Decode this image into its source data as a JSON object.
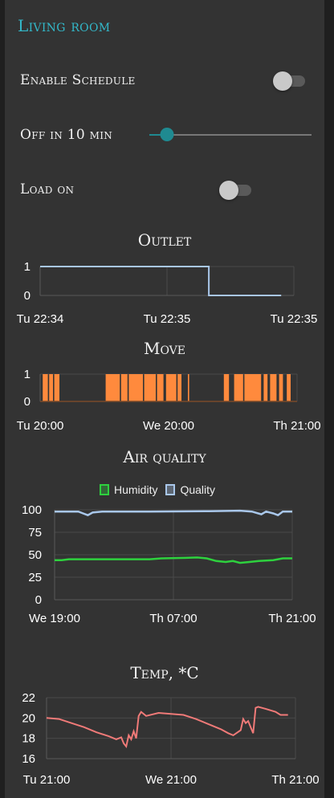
{
  "group": {
    "title": "Living room"
  },
  "controls": {
    "schedule": {
      "label": "Enable Schedule",
      "on": false
    },
    "timer": {
      "label": "Off in 10 min",
      "level": 0.11
    },
    "load": {
      "label": "Load on",
      "on": false
    }
  },
  "colors": {
    "background": "#333333",
    "title_accent": "#33b8c9",
    "slider_accent": "#1f8a91",
    "outlet_line": "#a9c7ea",
    "move_bars": "#ff8a3d",
    "humidity": "#2ed13e",
    "quality": "#a9c7ea",
    "temp": "#f07a78"
  },
  "chart_data": [
    {
      "type": "line",
      "title": "Outlet",
      "x_ticks": [
        "Tu 22:34",
        "Tu 22:35",
        "Tu 22:35"
      ],
      "y_ticks": [
        "1",
        "0"
      ],
      "ylim": [
        0,
        1
      ],
      "grid": true,
      "series": [
        {
          "points": [
            [
              0,
              1
            ],
            [
              0.665,
              1
            ],
            [
              0.665,
              0
            ],
            [
              0.95,
              0
            ]
          ]
        }
      ]
    },
    {
      "type": "bar",
      "title": "Move",
      "x_ticks": [
        "Tu 20:00",
        "We 20:00",
        "Th 21:00"
      ],
      "y_ticks": [
        "1",
        "0"
      ],
      "ylim": [
        0,
        1
      ],
      "grid": true,
      "on_intervals": [
        [
          0.01,
          0.03
        ],
        [
          0.035,
          0.05
        ],
        [
          0.055,
          0.075
        ],
        [
          0.255,
          0.31
        ],
        [
          0.315,
          0.34
        ],
        [
          0.345,
          0.4
        ],
        [
          0.405,
          0.45
        ],
        [
          0.455,
          0.48
        ],
        [
          0.49,
          0.53
        ],
        [
          0.535,
          0.55
        ],
        [
          0.575,
          0.58
        ],
        [
          0.715,
          0.735
        ],
        [
          0.755,
          0.79
        ],
        [
          0.795,
          0.86
        ],
        [
          0.87,
          0.885
        ],
        [
          0.895,
          0.92
        ],
        [
          0.93,
          0.945
        ],
        [
          0.96,
          0.975
        ]
      ]
    },
    {
      "type": "line",
      "title": "Air quality",
      "legend": [
        "Humidity",
        "Quality"
      ],
      "x_ticks": [
        "We 19:00",
        "Th 07:00",
        "Th 21:00"
      ],
      "y_ticks": [
        "100",
        "75",
        "50",
        "25",
        "0"
      ],
      "ylim": [
        0,
        100
      ],
      "grid": true,
      "series": [
        {
          "name": "Humidity",
          "points": [
            [
              0,
              44
            ],
            [
              0.03,
              44
            ],
            [
              0.06,
              45
            ],
            [
              0.2,
              45
            ],
            [
              0.4,
              45
            ],
            [
              0.45,
              46
            ],
            [
              0.55,
              46.5
            ],
            [
              0.6,
              47
            ],
            [
              0.64,
              46
            ],
            [
              0.68,
              43
            ],
            [
              0.72,
              42
            ],
            [
              0.75,
              43
            ],
            [
              0.78,
              41
            ],
            [
              0.82,
              42
            ],
            [
              0.86,
              43
            ],
            [
              0.92,
              44
            ],
            [
              0.96,
              46
            ],
            [
              1,
              46
            ]
          ]
        },
        {
          "name": "Quality",
          "points": [
            [
              0,
              98
            ],
            [
              0.1,
              98
            ],
            [
              0.12,
              96
            ],
            [
              0.14,
              94
            ],
            [
              0.16,
              97
            ],
            [
              0.2,
              98
            ],
            [
              0.4,
              98
            ],
            [
              0.65,
              98.5
            ],
            [
              0.78,
              99
            ],
            [
              0.83,
              98
            ],
            [
              0.87,
              95
            ],
            [
              0.89,
              98
            ],
            [
              0.92,
              96
            ],
            [
              0.94,
              94
            ],
            [
              0.96,
              98
            ],
            [
              1,
              98
            ]
          ]
        }
      ]
    },
    {
      "type": "line",
      "title": "Temp, *C",
      "x_ticks": [
        "Tu 21:00",
        "We 21:00",
        "Th 21:00"
      ],
      "y_ticks": [
        "22",
        "20",
        "18",
        "16"
      ],
      "ylim": [
        16,
        22
      ],
      "grid": true,
      "series": [
        {
          "points": [
            [
              0,
              20
            ],
            [
              0.05,
              19.9
            ],
            [
              0.1,
              19.5
            ],
            [
              0.15,
              19.1
            ],
            [
              0.2,
              18.6
            ],
            [
              0.25,
              18.2
            ],
            [
              0.28,
              17.9
            ],
            [
              0.3,
              18.1
            ],
            [
              0.31,
              17.5
            ],
            [
              0.32,
              17.2
            ],
            [
              0.33,
              18.3
            ],
            [
              0.34,
              17.9
            ],
            [
              0.35,
              18.7
            ],
            [
              0.36,
              18.0
            ],
            [
              0.37,
              20.2
            ],
            [
              0.38,
              20.6
            ],
            [
              0.4,
              20.2
            ],
            [
              0.45,
              20.5
            ],
            [
              0.5,
              20.4
            ],
            [
              0.55,
              20.3
            ],
            [
              0.6,
              19.9
            ],
            [
              0.65,
              19.4
            ],
            [
              0.7,
              18.9
            ],
            [
              0.73,
              18.5
            ],
            [
              0.75,
              18.3
            ],
            [
              0.78,
              18.8
            ],
            [
              0.79,
              19.9
            ],
            [
              0.8,
              19.5
            ],
            [
              0.81,
              19.7
            ],
            [
              0.82,
              19.1
            ],
            [
              0.83,
              18.5
            ],
            [
              0.84,
              21.0
            ],
            [
              0.85,
              21.1
            ],
            [
              0.88,
              20.9
            ],
            [
              0.92,
              20.6
            ],
            [
              0.94,
              20.3
            ],
            [
              0.97,
              20.3
            ]
          ]
        }
      ]
    }
  ]
}
